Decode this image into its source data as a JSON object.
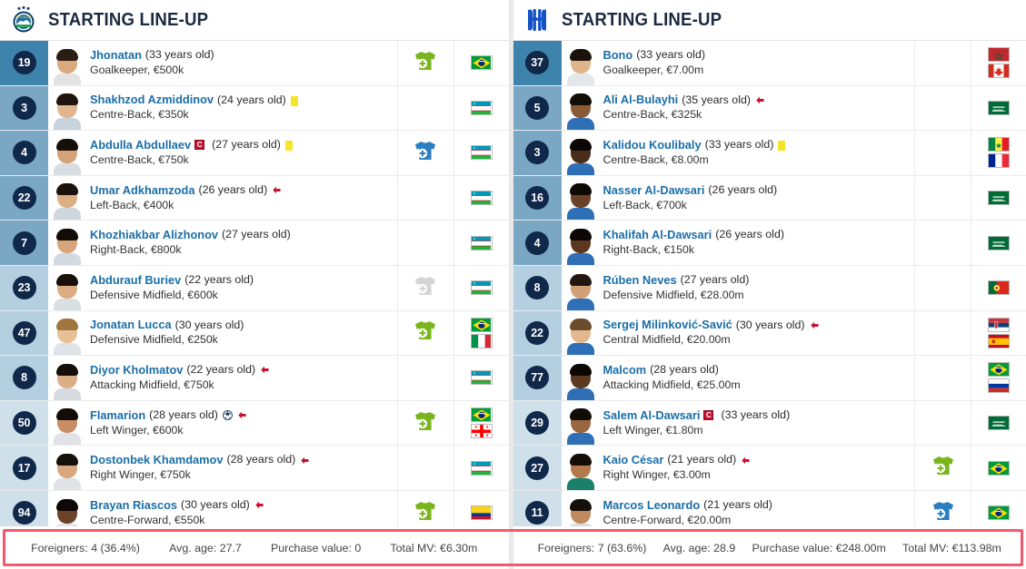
{
  "teams": [
    {
      "id": "left",
      "crest_name": "pakhtakor-crest",
      "header_title": "STARTING LINE-UP",
      "players": [
        {
          "number": "19",
          "name": "Jhonatan",
          "age_text": "(33 years old)",
          "position_value": "Goalkeeper, €500k",
          "captain": false,
          "yellow_card": false,
          "goal": false,
          "sub_off": false,
          "sub_icon": "sub-in-green",
          "slot": "gk",
          "flags": [
            "brazil"
          ],
          "skin": "#d9a87d",
          "hair": "#2b1d14",
          "shirt": "#e3e3e3"
        },
        {
          "number": "3",
          "name": "Shakhzod Azmiddinov",
          "age_text": "(24 years old)",
          "position_value": "Centre-Back, €350k",
          "captain": false,
          "yellow_card": true,
          "goal": false,
          "sub_off": false,
          "sub_icon": "none",
          "slot": "def",
          "flags": [
            "uzbekistan"
          ],
          "skin": "#e0b590",
          "hair": "#20150d",
          "shirt": "#c9d3dd"
        },
        {
          "number": "4",
          "name": "Abdulla Abdullaev",
          "age_text": "(27 years old)",
          "position_value": "Centre-Back, €750k",
          "captain": true,
          "yellow_card": true,
          "goal": false,
          "sub_off": false,
          "sub_icon": "sub-in-blue",
          "slot": "def",
          "flags": [
            "uzbekistan"
          ],
          "skin": "#d6a279",
          "hair": "#171009",
          "shirt": "#d8dde2"
        },
        {
          "number": "22",
          "name": "Umar Adkhamzoda",
          "age_text": "(26 years old)",
          "position_value": "Left-Back, €400k",
          "captain": false,
          "yellow_card": false,
          "goal": false,
          "sub_off": true,
          "sub_icon": "none",
          "slot": "def",
          "flags": [
            "uzbekistan"
          ],
          "skin": "#dcae84",
          "hair": "#1a120b",
          "shirt": "#cfd7de"
        },
        {
          "number": "7",
          "name": "Khozhiakbar Alizhonov",
          "age_text": "(27 years old)",
          "position_value": "Right-Back, €800k",
          "captain": false,
          "yellow_card": false,
          "goal": false,
          "sub_off": false,
          "sub_icon": "none",
          "slot": "def",
          "flags": [
            "uzbekistan"
          ],
          "skin": "#d8a67c",
          "hair": "#120c07",
          "shirt": "#d3dae1"
        },
        {
          "number": "23",
          "name": "Abdurauf Buriev",
          "age_text": "(22 years old)",
          "position_value": "Defensive Midfield, €600k",
          "captain": false,
          "yellow_card": false,
          "goal": false,
          "sub_off": false,
          "sub_icon": "sub-in-grey",
          "slot": "mid",
          "flags": [
            "uzbekistan"
          ],
          "skin": "#dcac82",
          "hair": "#181009",
          "shirt": "#dadfe4"
        },
        {
          "number": "47",
          "name": "Jonatan Lucca",
          "age_text": "(30 years old)",
          "position_value": "Defensive Midfield, €250k",
          "captain": false,
          "yellow_card": false,
          "goal": false,
          "sub_off": false,
          "sub_icon": "sub-in-green",
          "slot": "mid",
          "flags": [
            "brazil",
            "italy"
          ],
          "skin": "#e8c098",
          "hair": "#a0763f",
          "shirt": "#dfe3e8"
        },
        {
          "number": "8",
          "name": "Diyor Kholmatov",
          "age_text": "(22 years old)",
          "position_value": "Attacking Midfield, €750k",
          "captain": false,
          "yellow_card": false,
          "goal": false,
          "sub_off": true,
          "sub_icon": "none",
          "slot": "mid",
          "flags": [
            "uzbekistan"
          ],
          "skin": "#dcae86",
          "hair": "#150e08",
          "shirt": "#d5dbe1"
        },
        {
          "number": "50",
          "name": "Flamarion",
          "age_text": "(28 years old)",
          "position_value": "Left Winger, €600k",
          "captain": false,
          "yellow_card": false,
          "goal": true,
          "sub_off": true,
          "sub_icon": "sub-in-green",
          "slot": "att",
          "flags": [
            "brazil",
            "georgia"
          ],
          "skin": "#c98e63",
          "hair": "#120b06",
          "shirt": "#dfe3e7"
        },
        {
          "number": "17",
          "name": "Dostonbek Khamdamov",
          "age_text": "(28 years old)",
          "position_value": "Right Winger, €750k",
          "captain": false,
          "yellow_card": false,
          "goal": false,
          "sub_off": true,
          "sub_icon": "none",
          "slot": "att",
          "flags": [
            "uzbekistan"
          ],
          "skin": "#d9a77d",
          "hair": "#14100b",
          "shirt": "#dfe3e7"
        },
        {
          "number": "94",
          "name": "Brayan Riascos",
          "age_text": "(30 years old)",
          "position_value": "Centre-Forward, €550k",
          "captain": false,
          "yellow_card": false,
          "goal": false,
          "sub_off": true,
          "sub_icon": "sub-in-green",
          "slot": "att",
          "flags": [
            "colombia"
          ],
          "skin": "#6b4329",
          "hair": "#0d0805",
          "shirt": "#e2e6ea"
        }
      ],
      "footer": {
        "foreigners": "Foreigners: 4 (36.4%)",
        "avg_age": "Avg. age: 27.7",
        "purchase_value": "Purchase value: 0",
        "total_mv": "Total MV: €6.30m"
      }
    },
    {
      "id": "right",
      "crest_name": "al-hilal-crest",
      "header_title": "STARTING LINE-UP",
      "players": [
        {
          "number": "37",
          "name": "Bono",
          "age_text": "(33 years old)",
          "position_value": "Goalkeeper, €7.00m",
          "captain": false,
          "yellow_card": false,
          "goal": false,
          "sub_off": false,
          "sub_icon": "none",
          "slot": "gk",
          "flags": [
            "morocco",
            "canada"
          ],
          "skin": "#dfb48a",
          "hair": "#1a120b",
          "shirt": "#e4e7ea"
        },
        {
          "number": "5",
          "name": "Ali Al-Bulayhi",
          "age_text": "(35 years old)",
          "position_value": "Centre-Back, €325k",
          "captain": false,
          "yellow_card": false,
          "goal": false,
          "sub_off": true,
          "sub_icon": "none",
          "slot": "def",
          "flags": [
            "saudi-arabia"
          ],
          "skin": "#8a5a36",
          "hair": "#120c06",
          "shirt": "#2f6fb5"
        },
        {
          "number": "3",
          "name": "Kalidou Koulibaly",
          "age_text": "(33 years old)",
          "position_value": "Centre-Back, €8.00m",
          "captain": false,
          "yellow_card": true,
          "goal": false,
          "sub_off": false,
          "sub_icon": "none",
          "slot": "def",
          "flags": [
            "senegal",
            "france"
          ],
          "skin": "#4a2c18",
          "hair": "#0c0704",
          "shirt": "#2f6fb5"
        },
        {
          "number": "16",
          "name": "Nasser Al-Dawsari",
          "age_text": "(26 years old)",
          "position_value": "Left-Back, €700k",
          "captain": false,
          "yellow_card": false,
          "goal": false,
          "sub_off": false,
          "sub_icon": "none",
          "slot": "def",
          "flags": [
            "saudi-arabia"
          ],
          "skin": "#6b4228",
          "hair": "#0f0905",
          "shirt": "#2f6fb5"
        },
        {
          "number": "4",
          "name": "Khalifah Al-Dawsari",
          "age_text": "(26 years old)",
          "position_value": "Right-Back, €150k",
          "captain": false,
          "yellow_card": false,
          "goal": false,
          "sub_off": false,
          "sub_icon": "none",
          "slot": "def",
          "flags": [
            "saudi-arabia"
          ],
          "skin": "#5c3720",
          "hair": "#0c0704",
          "shirt": "#2f6fb5"
        },
        {
          "number": "8",
          "name": "Rúben Neves",
          "age_text": "(27 years old)",
          "position_value": "Defensive Midfield, €28.00m",
          "captain": false,
          "yellow_card": false,
          "goal": false,
          "sub_off": false,
          "sub_icon": "none",
          "slot": "mid",
          "flags": [
            "portugal"
          ],
          "skin": "#d2a076",
          "hair": "#231610",
          "shirt": "#2f6fb5"
        },
        {
          "number": "22",
          "name": "Sergej Milinković-Savić",
          "age_text": "(30 years old)",
          "position_value": "Central Midfield, €20.00m",
          "captain": false,
          "yellow_card": false,
          "goal": false,
          "sub_off": true,
          "sub_icon": "none",
          "slot": "mid",
          "flags": [
            "serbia",
            "spain"
          ],
          "skin": "#e2b98f",
          "hair": "#6b4c2c",
          "shirt": "#2f6fb5"
        },
        {
          "number": "77",
          "name": "Malcom",
          "age_text": "(28 years old)",
          "position_value": "Attacking Midfield, €25.00m",
          "captain": false,
          "yellow_card": false,
          "goal": false,
          "sub_off": false,
          "sub_icon": "none",
          "slot": "mid",
          "flags": [
            "brazil",
            "russia"
          ],
          "skin": "#5c3a22",
          "hair": "#0d0704",
          "shirt": "#2f6fb5"
        },
        {
          "number": "29",
          "name": "Salem Al-Dawsari",
          "age_text": "(33 years old)",
          "position_value": "Left Winger, €1.80m",
          "captain": true,
          "yellow_card": false,
          "goal": false,
          "sub_off": false,
          "sub_icon": "none",
          "slot": "att",
          "flags": [
            "saudi-arabia"
          ],
          "skin": "#9a6640",
          "hair": "#120c07",
          "shirt": "#2f6fb5"
        },
        {
          "number": "27",
          "name": "Kaio César",
          "age_text": "(21 years old)",
          "position_value": "Right Winger, €3.00m",
          "captain": false,
          "yellow_card": false,
          "goal": false,
          "sub_off": true,
          "sub_icon": "sub-in-green",
          "slot": "att",
          "flags": [
            "brazil"
          ],
          "skin": "#b4794c",
          "hair": "#140d07",
          "shirt": "#1a7f6b"
        },
        {
          "number": "11",
          "name": "Marcos Leonardo",
          "age_text": "(21 years old)",
          "position_value": "Centre-Forward, €20.00m",
          "captain": false,
          "yellow_card": false,
          "goal": false,
          "sub_off": false,
          "sub_icon": "sub-in-blue",
          "slot": "att",
          "flags": [
            "brazil"
          ],
          "skin": "#c08a5c",
          "hair": "#15100a",
          "shirt": "#d9dde1"
        }
      ],
      "footer": {
        "foreigners": "Foreigners: 7 (63.6%)",
        "avg_age": "Avg. age: 28.9",
        "purchase_value": "Purchase value: €248.00m",
        "total_mv": "Total MV: €113.98m"
      }
    }
  ],
  "colors": {
    "slot_gk": "#3d83ac",
    "slot_def": "#7aa8c4",
    "slot_mid": "#b4cfe0",
    "slot_att": "#cfe0ea",
    "number_badge": "#10284a",
    "player_link": "#1a6ea8",
    "highlight_border": "#f5576c",
    "sub_in_green": "#7ab51d",
    "sub_in_blue": "#2b7fc0",
    "sub_in_grey": "#d5d5d5",
    "card_yellow": "#f5e526",
    "captain_red": "#c8102e",
    "arrow_red": "#c8102e"
  },
  "icon_names": {
    "sub_in": "substitution-shirt-icon",
    "goal": "football-goal-icon",
    "sub_off": "substituted-off-arrow-icon",
    "captain": "captain-armband-icon",
    "yellow_card": "yellow-card-icon"
  }
}
